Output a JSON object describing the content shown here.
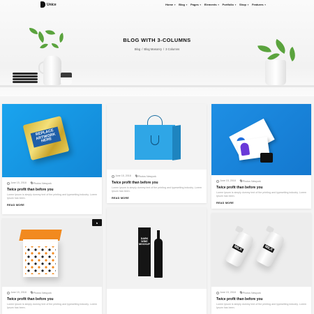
{
  "logo": {
    "text": "Unice"
  },
  "nav": [
    {
      "label": "Home"
    },
    {
      "label": "Blog"
    },
    {
      "label": "Pages"
    },
    {
      "label": "Elements"
    },
    {
      "label": "Portfolio"
    },
    {
      "label": "Shop"
    },
    {
      "label": "Features"
    }
  ],
  "hero": {
    "title": "BLOG WITH 3-COLUMNS",
    "breadcrumb": [
      "Blog",
      "Blog Masonry",
      "3 Columns"
    ]
  },
  "cards": [
    {
      "date": "June 15, 2018",
      "author": "Photos Newyork",
      "title": "Twice profit than before you",
      "excerpt": "Lorem Ipsum is simply dummy text of the printing and typesetting industry. Lorem Ipsum has been.",
      "read_more": "READ MORE",
      "image_text": "REPLACE ARTWORK HERE"
    },
    {
      "date": "June 15, 2018",
      "author": "Photos Newyork",
      "title": "Twice profit than before you",
      "excerpt": "Lorem Ipsum is simply dummy text of the printing and typesetting industry. Lorem Ipsum has been.",
      "read_more": "READ MORE"
    },
    {
      "date": "June 15, 2018",
      "author": "Photos Newyork",
      "title": "Twice profit than before you",
      "excerpt": "Lorem Ipsum is simply dummy text of the printing and typesetting industry. Lorem Ipsum has been.",
      "read_more": "READ MORE"
    },
    {
      "date": "June 15, 2018",
      "author": "Photos Newyork",
      "title": "Twice profit than before you",
      "excerpt": "Lorem Ipsum is simply dummy text of the printing and typesetting industry. Lorem Ipsum has been."
    },
    {
      "image_text": "DARK WINE MOCKUP"
    },
    {
      "date": "June 15, 2018",
      "author": "Photos Newyork",
      "title": "Twice profit than before you",
      "excerpt": "Lorem Ipsum is simply dummy text of the printing and typesetting industry. Lorem Ipsum has been.",
      "image_text": "MILK"
    }
  ],
  "colors": {
    "blue_bg": "#1f9ae0",
    "accent_orange": "#f28a1f",
    "text_dark": "#111111"
  }
}
